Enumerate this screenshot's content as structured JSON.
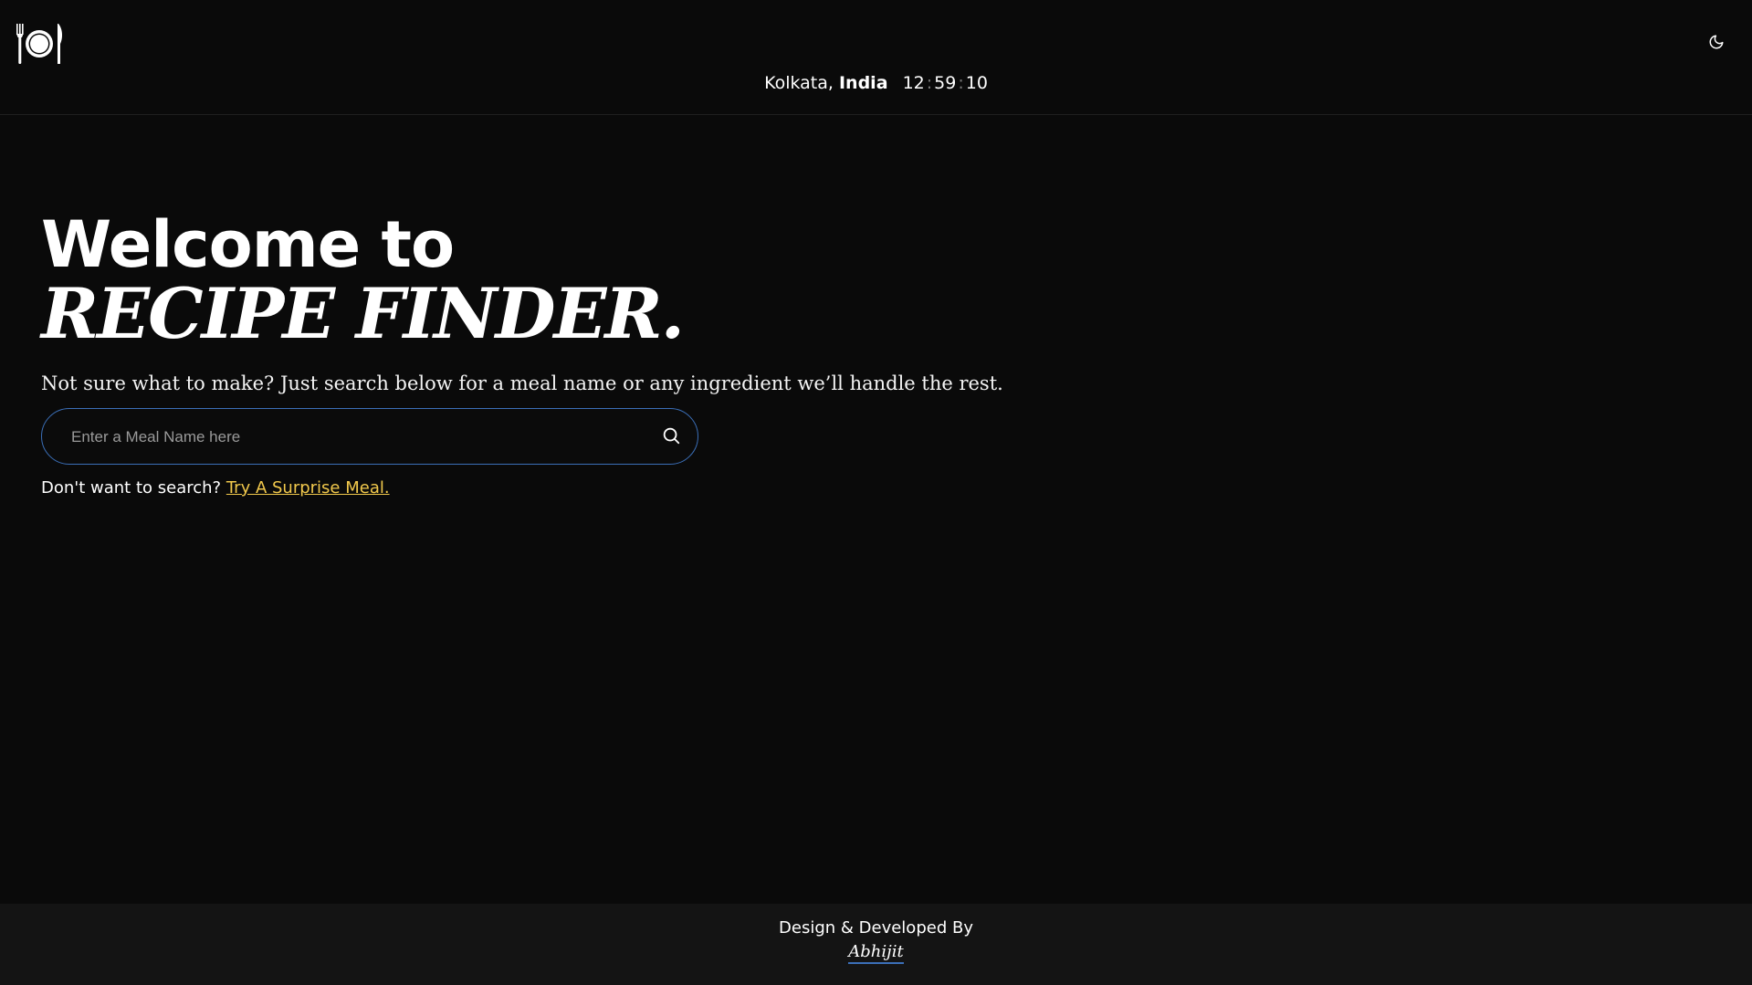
{
  "header": {
    "logo_icon": "plate-fork-knife-icon",
    "theme_toggle_icon": "moon-icon",
    "location": {
      "city": "Kolkata,",
      "country": "India",
      "clock": {
        "hours": "12",
        "minutes": "59",
        "seconds": "10",
        "separator": ":"
      }
    }
  },
  "hero": {
    "welcome": "Welcome to",
    "brand": "RECIPE FINDER.",
    "tagline": "Not sure what to make? Just search below for a meal name or any ingredient we’ll handle the rest."
  },
  "search": {
    "placeholder": "Enter a Meal Name here",
    "value": "",
    "icon": "search-icon",
    "border_color": "#3b6fb8"
  },
  "surprise": {
    "prompt": "Don't want to search?",
    "link_label": "Try A Surprise Meal.",
    "link_color": "#f2c94c"
  },
  "footer": {
    "credit": "Design & Developed By",
    "author": "Abhijit"
  },
  "colors": {
    "background": "#0a0a0a",
    "footer_background": "#141414",
    "accent": "#3b6fb8"
  }
}
